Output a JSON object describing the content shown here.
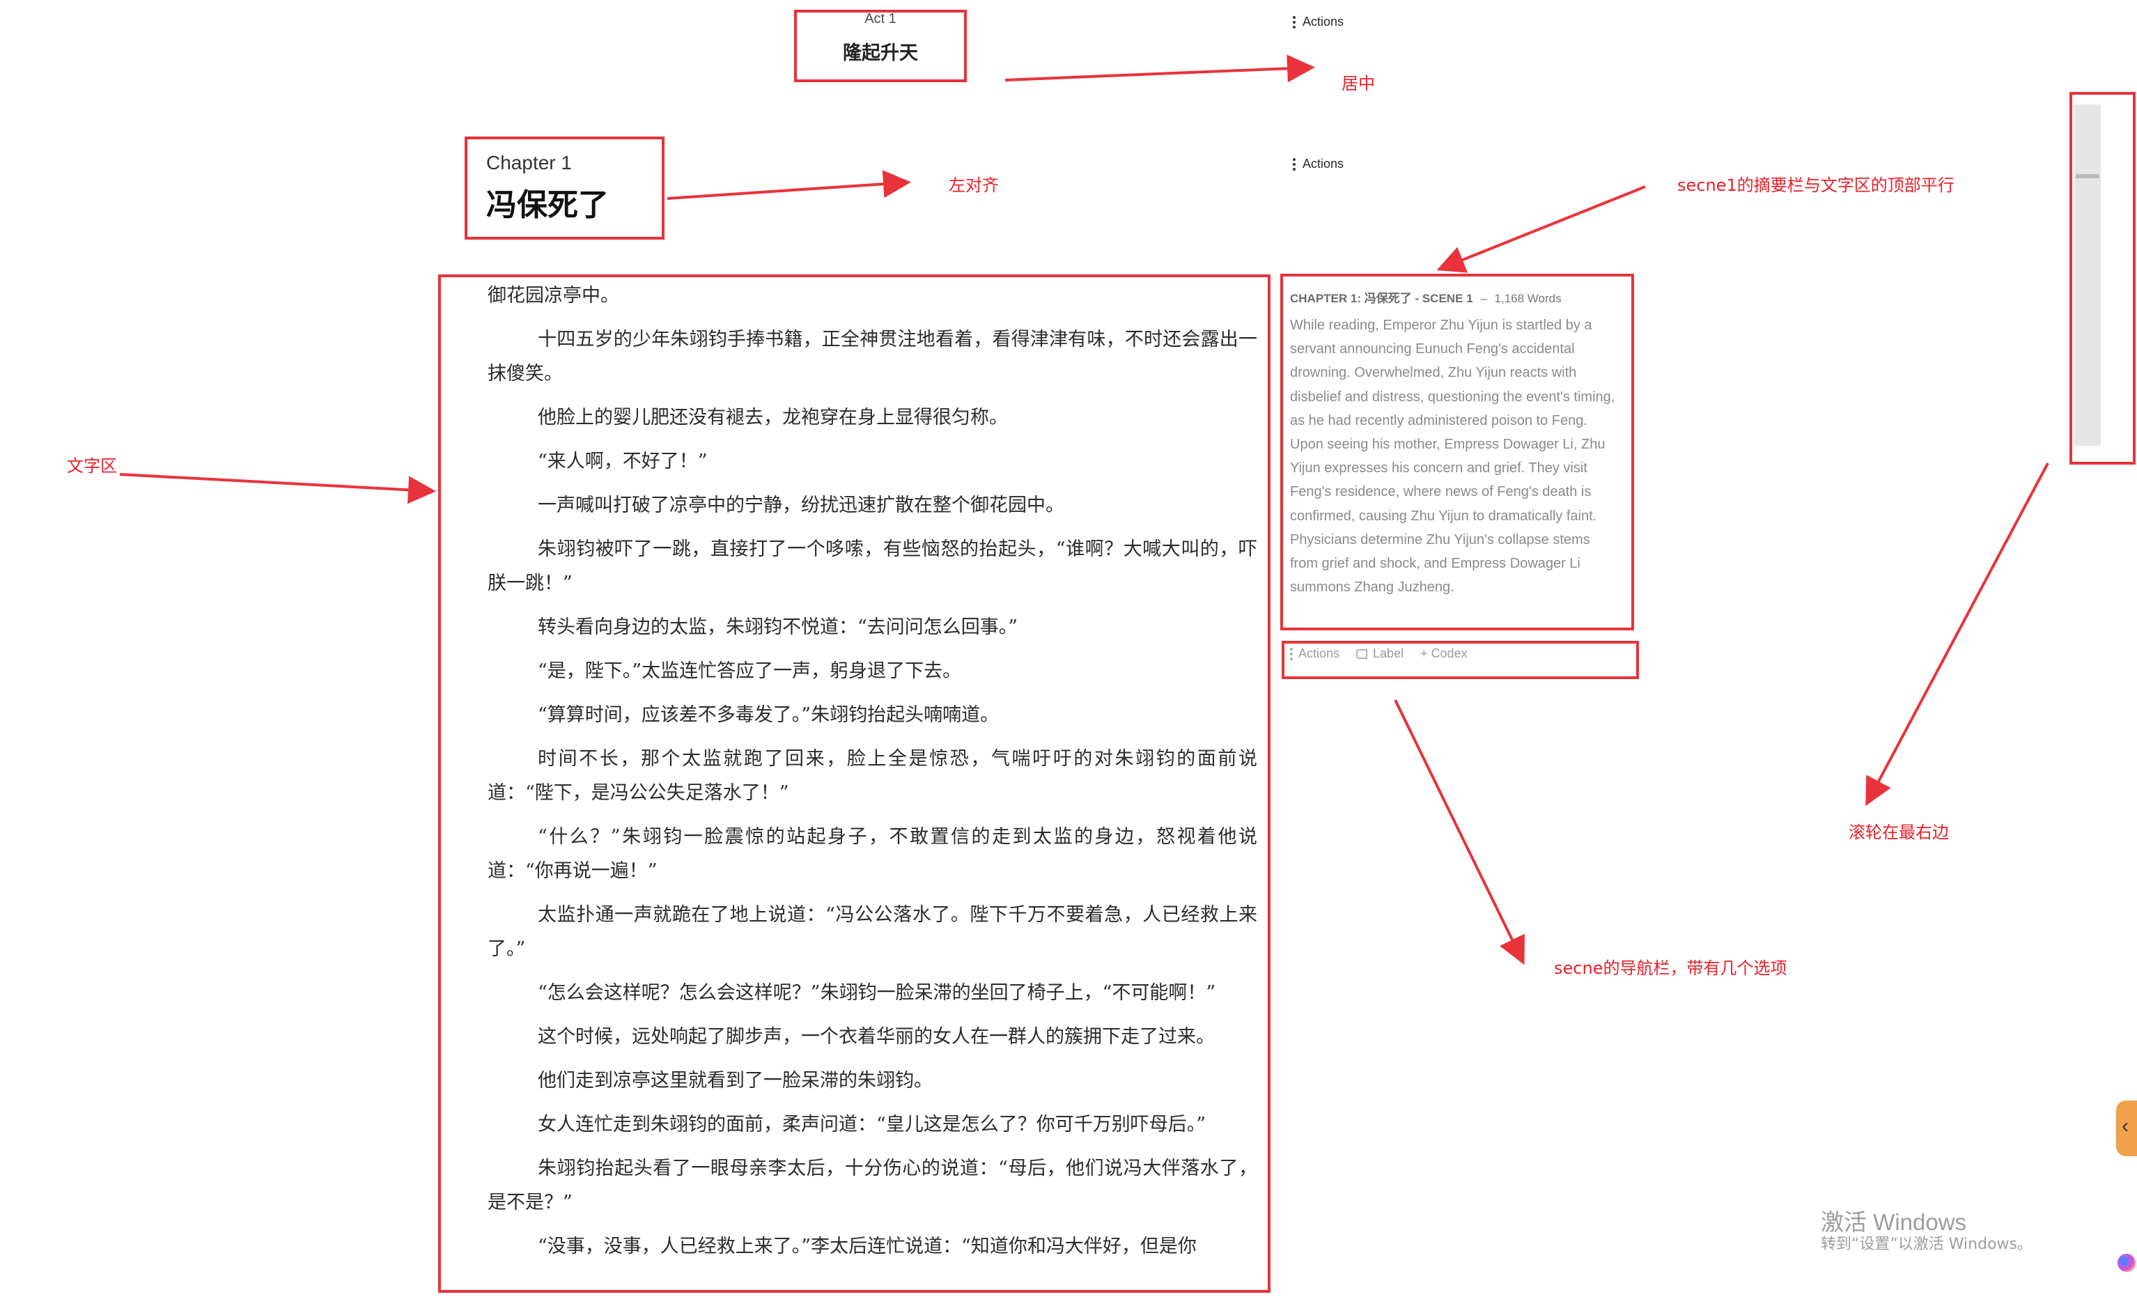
{
  "act": {
    "label": "Act 1",
    "title": "隆起升天",
    "actions_label": "Actions"
  },
  "chapter": {
    "label": "Chapter 1",
    "title": "冯保死了",
    "actions_label": "Actions"
  },
  "scene": {
    "heading": "CHAPTER 1: 冯保死了 - SCENE 1",
    "separator": "–",
    "word_count": "1,168 Words",
    "summary": "While reading, Emperor Zhu Yijun is startled by a servant announcing Eunuch Feng's accidental drowning. Overwhelmed, Zhu Yijun reacts with disbelief and distress, questioning the event's timing, as he had recently administered poison to Feng. Upon seeing his mother, Empress Dowager Li, Zhu Yijun expresses his concern and grief. They visit Feng's residence, where news of Feng's death is confirmed, causing Zhu Yijun to dramatically faint. Physicians determine Zhu Yijun's collapse stems from grief and shock, and Empress Dowager Li summons Zhang Juzheng.",
    "nav": {
      "actions": "Actions",
      "label": "Label",
      "codex": "+ Codex"
    }
  },
  "text_paragraphs": [
    "御花园凉亭中。",
    "十四五岁的少年朱翊钧手捧书籍，正全神贯注地看着，看得津津有味，不时还会露出一抹傻笑。",
    "他脸上的婴儿肥还没有褪去，龙袍穿在身上显得很匀称。",
    "“来人啊，不好了！”",
    "一声喊叫打破了凉亭中的宁静，纷扰迅速扩散在整个御花园中。",
    "朱翊钧被吓了一跳，直接打了一个哆嗦，有些恼怒的抬起头，“谁啊？大喊大叫的，吓朕一跳！”",
    "转头看向身边的太监，朱翊钧不悦道：“去问问怎么回事。”",
    "“是，陛下。”太监连忙答应了一声，躬身退了下去。",
    "“算算时间，应该差不多毒发了。”朱翊钧抬起头喃喃道。",
    "时间不长，那个太监就跑了回来，脸上全是惊恐，气喘吁吁的对朱翊钧的面前说道：“陛下，是冯公公失足落水了！”",
    "“什么？”朱翊钧一脸震惊的站起身子，不敢置信的走到太监的身边，怒视着他说道：“你再说一遍！”",
    "太监扑通一声就跪在了地上说道：“冯公公落水了。陛下千万不要着急，人已经救上来了。”",
    "“怎么会这样呢？怎么会这样呢？”朱翊钧一脸呆滞的坐回了椅子上，“不可能啊！”",
    "这个时候，远处响起了脚步声，一个衣着华丽的女人在一群人的簇拥下走了过来。",
    "他们走到凉亭这里就看到了一脸呆滞的朱翊钧。",
    "女人连忙走到朱翊钧的面前，柔声问道：“皇儿这是怎么了？你可千万别吓母后。”",
    "朱翊钧抬起头看了一眼母亲李太后，十分伤心的说道：“母后，他们说冯大伴落水了，是不是？”",
    "“没事，没事，人已经救上来了。”李太后连忙说道：“知道你和冯大伴好，但是你"
  ],
  "annotations": {
    "center": "居中",
    "left_align": "左对齐",
    "summary_parallel": "secne1的摘要栏与文字区的顶部平行",
    "text_area": "文字区",
    "scroll_right": "滚轮在最右边",
    "scene_nav": "secne的导航栏，带有几个选项"
  },
  "watermark": {
    "line1": "激活 Windows",
    "line2": "转到“设置”以激活 Windows。"
  },
  "colors": {
    "annotation_red": "#e8333a",
    "summary_text": "#8a8a8a",
    "side_tab": "#f0a24a"
  },
  "icons": [
    "more-vertical-icon",
    "tag-icon",
    "chevron-left-icon",
    "assistant-icon"
  ]
}
